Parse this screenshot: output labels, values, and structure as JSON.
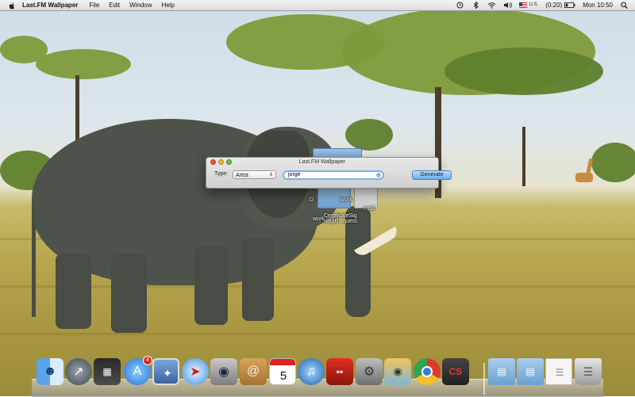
{
  "menubar": {
    "app_name": "Last.FM Wallpaper",
    "menus": [
      "File",
      "Edit",
      "Window",
      "Help"
    ],
    "status": {
      "battery": "(0:20)",
      "input_source": "U.S.",
      "clock": "Mon 10:50"
    }
  },
  "desktop_files": [
    {
      "label": ".D"
    },
    {
      "label": "Work"
    },
    {
      "label": "rnp8"
    },
    {
      "label": "work store"
    },
    {
      "label": "CertificateSig\nningR...quest"
    }
  ],
  "window": {
    "title": "Last.FM Wallpaper",
    "type_label": "Type:",
    "type_selected": "Artist",
    "search_value": "jorge",
    "generate_label": "Generate"
  },
  "dock": {
    "apps": [
      {
        "name": "finder"
      },
      {
        "name": "launchpad"
      },
      {
        "name": "mission-control"
      },
      {
        "name": "app-store",
        "badge": "4"
      },
      {
        "name": "preview"
      },
      {
        "name": "safari"
      },
      {
        "name": "facetime"
      },
      {
        "name": "address-book"
      },
      {
        "name": "ical",
        "date": "5"
      },
      {
        "name": "itunes"
      },
      {
        "name": "photo-booth"
      },
      {
        "name": "system-preferences"
      },
      {
        "name": "iphoto"
      },
      {
        "name": "chrome"
      },
      {
        "name": "adobe-cs"
      }
    ],
    "stacks": [
      {
        "name": "applications-folder"
      },
      {
        "name": "documents-folder"
      },
      {
        "name": "downloads-stack"
      },
      {
        "name": "trash"
      }
    ]
  },
  "colors": {
    "accent": "#6ba9ee",
    "close": "#e9523c",
    "minimize": "#e9b43a",
    "zoom": "#6fb94a",
    "badge": "#e0281f"
  }
}
